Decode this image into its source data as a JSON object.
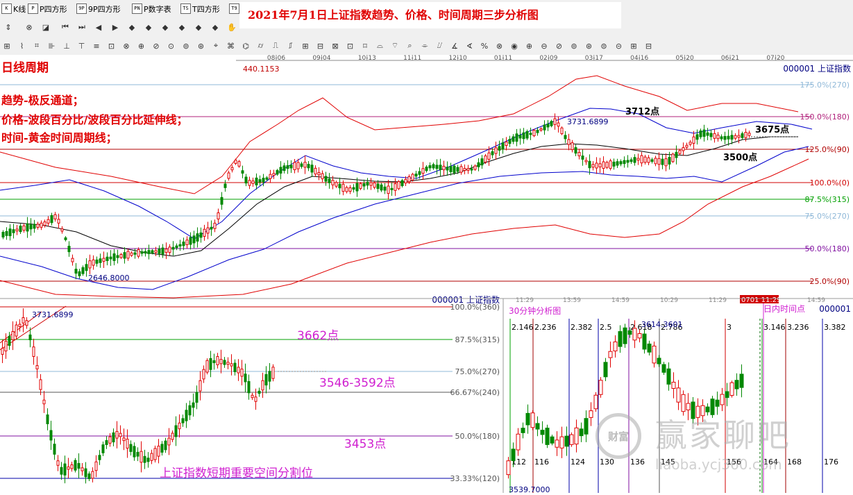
{
  "toolbar1": {
    "items": [
      {
        "icon": "K",
        "label": "K线"
      },
      {
        "icon": "P",
        "label": "P四方形"
      },
      {
        "icon": "9P",
        "label": "9P四方形"
      },
      {
        "icon": "PN",
        "label": "P数字表"
      },
      {
        "icon": "TS",
        "label": "T四方形"
      },
      {
        "icon": "T9",
        "label": ""
      }
    ]
  },
  "title": "2021年7月1日上证指数趋势、价格、时间周期三步分析图",
  "main_chart": {
    "period_label": "日线周期",
    "annotations": [
      "趋势-极反通道；",
      "价格-波段百分比/波段百分比延伸线；",
      "时间-黄金时间周期线；"
    ],
    "index_name": "000001 上证指数",
    "top_value": "440.1153",
    "date_ticks": [
      "08-06",
      "09-04",
      "10-13",
      "11-11",
      "12-10",
      "01-11",
      "02-09",
      "03-17",
      "04-16",
      "05-20",
      "06-21",
      "07-20"
    ],
    "levels": [
      {
        "label": "175.0%(270)",
        "color": "#8fb8d8"
      },
      {
        "label": "150.0%(180)",
        "color": "#b0207a"
      },
      {
        "label": "125.0%(90)",
        "color": "#b00000"
      },
      {
        "label": "100.0%(0)",
        "color": "#d00000"
      },
      {
        "label": "87.5%(315)",
        "color": "#00a000"
      },
      {
        "label": "75.0%(270)",
        "color": "#8fb8d8"
      },
      {
        "label": "50.0%(180)",
        "color": "#8010a0"
      },
      {
        "label": "25.0%(90)",
        "color": "#b00000"
      }
    ],
    "peak_value": "3731.6899",
    "low_value": "2646.8000",
    "point_labels": [
      "3712点",
      "3675点",
      "3500点"
    ]
  },
  "lower_left": {
    "index_name": "000001 上证指数",
    "peak_value": "3731.6899",
    "levels": [
      "100.0%(360)",
      "87.5%(315)",
      "75.0%(270)",
      "66.67%(240)",
      "50.0%(180)",
      "33.33%(120)"
    ],
    "price_labels": [
      "3662点",
      "3546-3592点",
      "3453点"
    ],
    "caption": "上证指数短期重要空间分割位"
  },
  "lower_right": {
    "title": "30分钟分析图",
    "index_name": "000001",
    "intraday_label": "日内时间点",
    "current_time": "0701 11:29",
    "time_ticks": [
      "11:29",
      "13:59",
      "14:59",
      "10:29",
      "11:29",
      "14:59"
    ],
    "high_value": "3614.3601",
    "low_value": "3539.7000",
    "cycle_labels_top": [
      "2.146",
      "2.236",
      "2.382",
      "2.5",
      "2.618",
      "2.786",
      "3",
      "3.146",
      "3.236",
      "3.382"
    ],
    "cycle_labels_bottom": [
      "112",
      "116",
      "124",
      "130",
      "136",
      "145",
      "156",
      "164",
      "168",
      "176"
    ]
  },
  "watermark": {
    "text": "赢家聊吧",
    "url": "liaoba.ycj360.com",
    "seal_text": "财富"
  }
}
